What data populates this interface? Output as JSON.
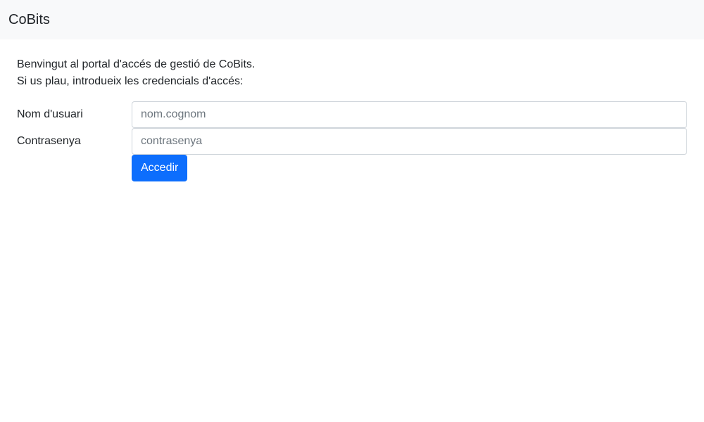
{
  "navbar": {
    "brand": "CoBits"
  },
  "intro": {
    "line1": "Benvingut al portal d'accés de gestió de CoBits.",
    "line2": "Si us plau, introdueix les credencials d'accés:"
  },
  "form": {
    "username": {
      "label": "Nom d'usuari",
      "placeholder": "nom.cognom",
      "value": ""
    },
    "password": {
      "label": "Contrasenya",
      "placeholder": "contrasenya",
      "value": ""
    },
    "submit_label": "Accedir"
  },
  "colors": {
    "navbar_bg": "#f8f9fa",
    "primary": "#0d6efd",
    "text": "#212529",
    "placeholder": "#6c757d"
  }
}
